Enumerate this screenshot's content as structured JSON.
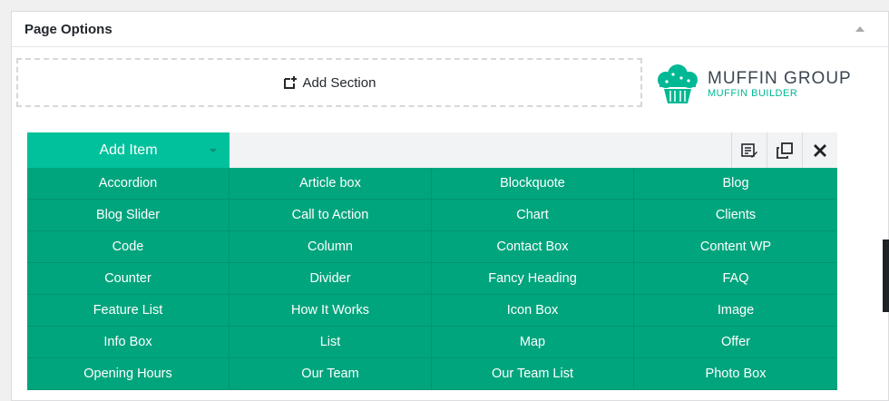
{
  "panel": {
    "title": "Page Options"
  },
  "builder": {
    "add_section_label": "Add Section",
    "logo": {
      "title": "MUFFIN GROUP",
      "subtitle": "MUFFIN BUILDER"
    },
    "add_item_label": "Add Item",
    "items": [
      "Accordion",
      "Article box",
      "Blockquote",
      "Blog",
      "Blog Slider",
      "Call to Action",
      "Chart",
      "Clients",
      "Code",
      "Column",
      "Contact Box",
      "Content WP",
      "Counter",
      "Divider",
      "Fancy Heading",
      "FAQ",
      "Feature List",
      "How It Works",
      "Icon Box",
      "Image",
      "Info Box",
      "List",
      "Map",
      "Offer",
      "Opening Hours",
      "Our Team",
      "Our Team List",
      "Photo Box"
    ]
  },
  "colors": {
    "accent": "#00c19c",
    "grid": "#00a57d"
  },
  "icons": [
    "add-section-icon",
    "muffin-logo-icon",
    "edit-icon",
    "duplicate-icon",
    "close-icon"
  ]
}
